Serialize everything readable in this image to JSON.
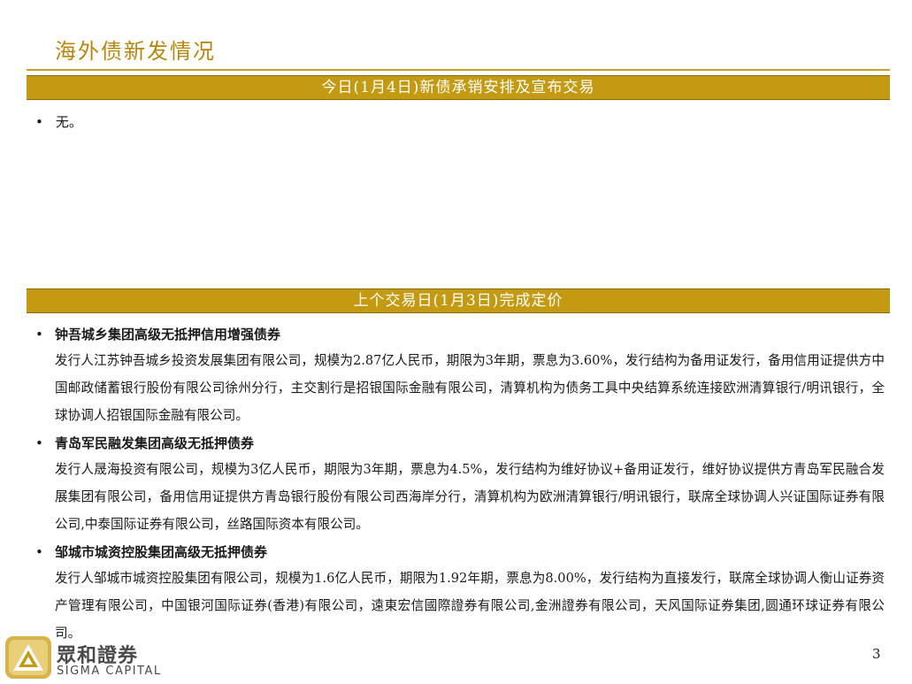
{
  "title": "海外债新发情况",
  "section_today": "今日(1月4日)新债承销安排及宣布交易",
  "today_item": "无。",
  "section_prev": "上个交易日(1月3日)完成定价",
  "bullet": "•",
  "bonds": [
    {
      "name": "钟吾城乡集团高级无抵押信用增强债券",
      "detail": "发行人江苏钟吾城乡投资发展集团有限公司，规模为2.87亿人民币，期限为3年期，票息为3.60%，发行结构为备用证发行，备用信用证提供方中国邮政储蓄银行股份有限公司徐州分行，主交割行是招银国际金融有限公司，清算机构为债务工具中央结算系统连接欧洲清算银行/明讯银行，全球协调人招银国际金融有限公司。"
    },
    {
      "name": "青岛军民融发集团高级无抵押债券",
      "detail": "发行人晟海投资有限公司，规模为3亿人民币，期限为3年期，票息为4.5%，发行结构为维好协议+备用证发行，维好协议提供方青岛军民融合发展集团有限公司，备用信用证提供方青岛银行股份有限公司西海岸分行，清算机构为欧洲清算银行/明讯银行，联席全球协调人兴证国际证券有限公司,中泰国际证券有限公司，丝路国际资本有限公司。"
    },
    {
      "name": "邹城市城资控股集团高级无抵押债券",
      "detail": "发行人邹城市城资控股集团有限公司，规模为1.6亿人民币，期限为1.92年期，票息为8.00%，发行结构为直接发行，联席全球协调人衡山证券资产管理有限公司，中国银河国际证券(香港)有限公司，遠東宏信國際證券有限公司,金洲證券有限公司，天风国际证券集团,圆通环球证券有限公司。"
    }
  ],
  "footer": {
    "brand_cn": "眾和證券",
    "brand_en": "SIGMA CAPITAL",
    "page_number": "3"
  },
  "colors": {
    "gold": "#c49a12",
    "title_gold": "#b8860b"
  }
}
